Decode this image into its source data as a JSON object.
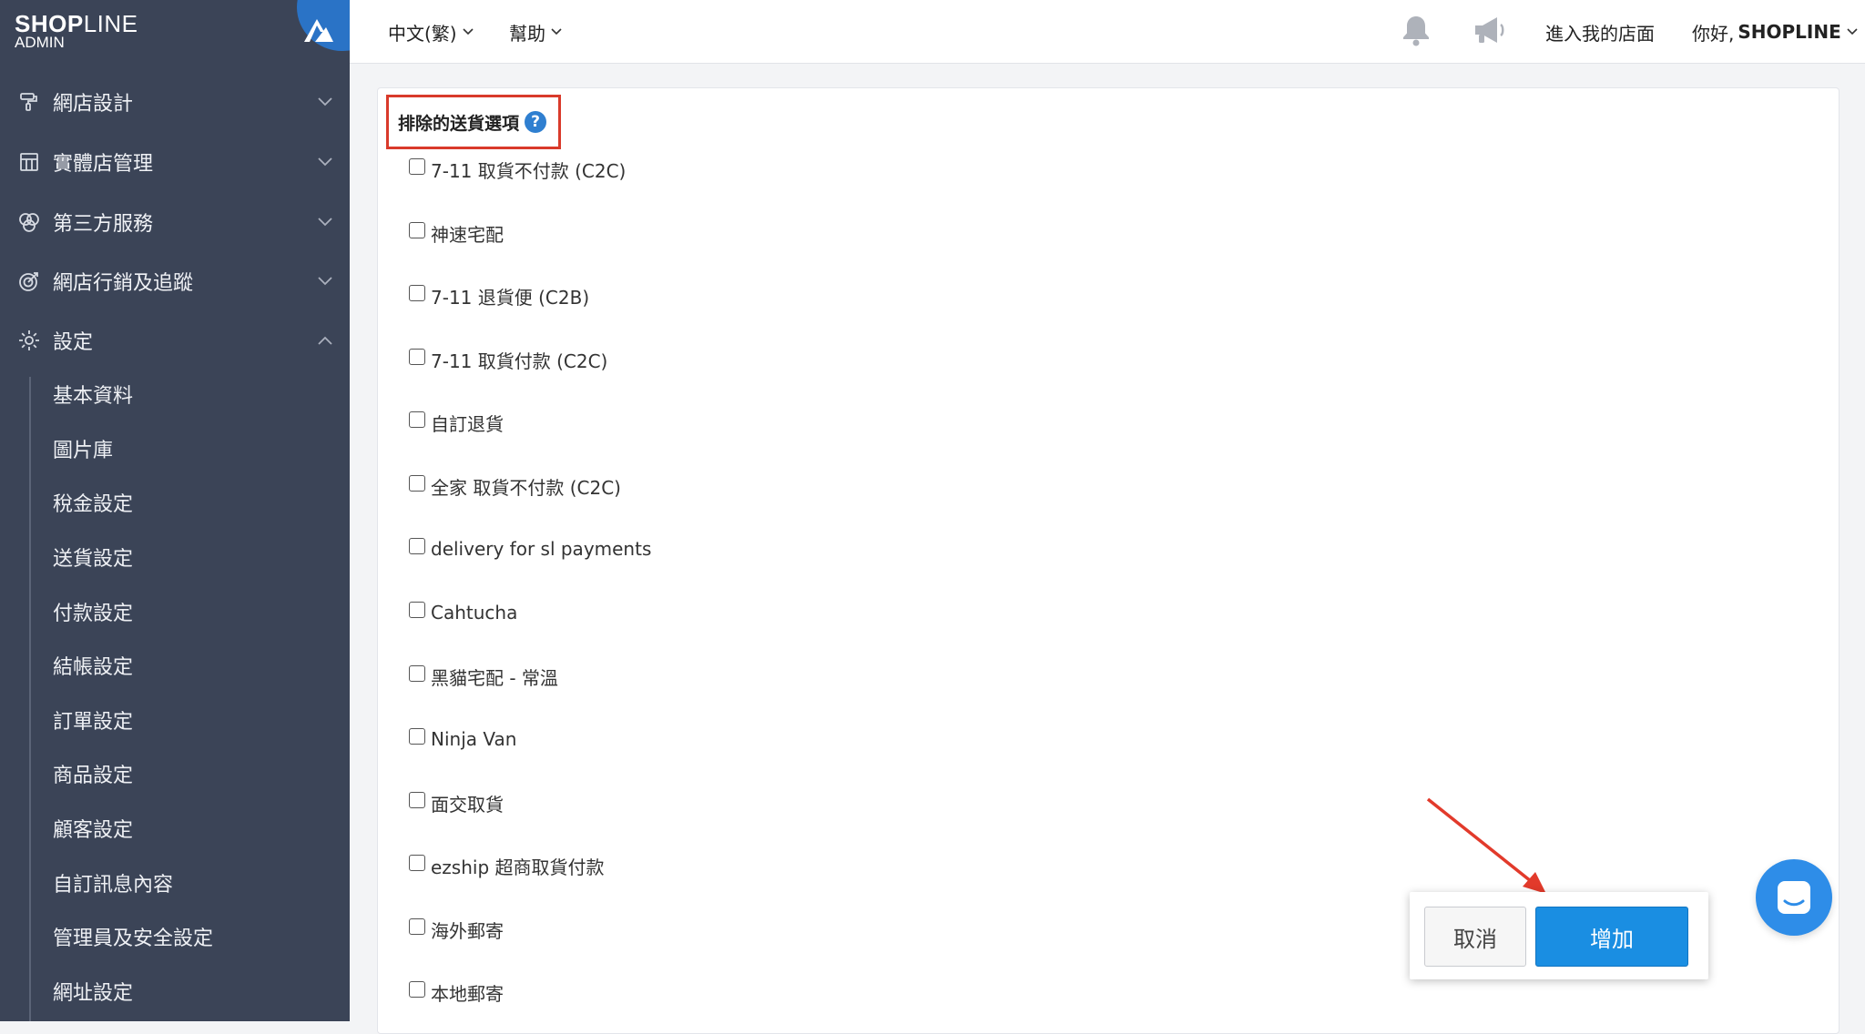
{
  "logo": {
    "brand_bold": "SHOP",
    "brand_thin": "LINE",
    "sub": "ADMIN"
  },
  "sidebar": {
    "items": [
      {
        "label": "網店設計",
        "icon": "paint-roller-icon"
      },
      {
        "label": "實體店管理",
        "icon": "store-icon"
      },
      {
        "label": "第三方服務",
        "icon": "circles-icon"
      },
      {
        "label": "網店行銷及追蹤",
        "icon": "target-icon"
      },
      {
        "label": "設定",
        "icon": "gear-icon"
      }
    ],
    "sub_items": [
      "基本資料",
      "圖片庫",
      "稅金設定",
      "送貨設定",
      "付款設定",
      "結帳設定",
      "訂單設定",
      "商品設定",
      "顧客設定",
      "自訂訊息內容",
      "管理員及安全設定",
      "網址設定"
    ]
  },
  "topbar": {
    "language": "中文(繁)",
    "help": "幫助",
    "enter_store": "進入我的店面",
    "greeting": "你好,",
    "user": "SHOPLINE"
  },
  "section": {
    "title": "排除的送貨選項",
    "help": "?"
  },
  "options": [
    "7-11 取貨不付款 (C2C)",
    "神速宅配",
    "7-11 退貨便 (C2B)",
    "7-11 取貨付款 (C2C)",
    "自訂退貨",
    "全家 取貨不付款 (C2C)",
    "delivery for sl payments",
    "Cahtucha",
    "黑貓宅配 - 常溫",
    "Ninja Van",
    "面交取貨",
    "ezship 超商取貨付款",
    "海外郵寄",
    "本地郵寄"
  ],
  "actions": {
    "cancel": "取消",
    "add": "增加"
  },
  "colors": {
    "sidebar_bg": "#3b4457",
    "primary": "#1a8ee2",
    "annotation": "#d93a2b"
  }
}
